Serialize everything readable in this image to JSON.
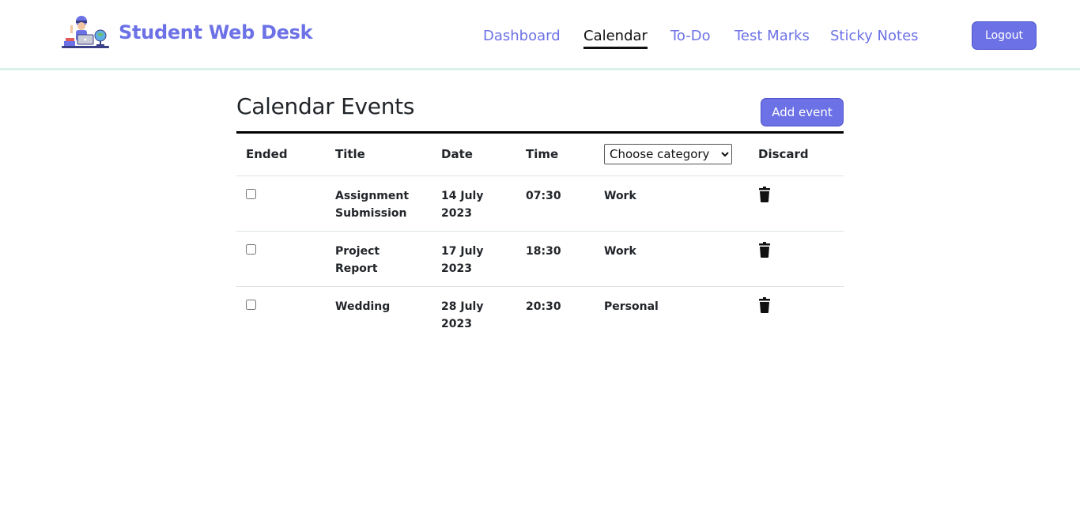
{
  "brand": {
    "name": "Student Web Desk",
    "logo_icon": "student-laptop-desk-icon"
  },
  "nav": {
    "items": [
      {
        "label": "Dashboard"
      },
      {
        "label": "Calendar"
      },
      {
        "label": "To-Do"
      },
      {
        "label": "Test Marks"
      },
      {
        "label": "Sticky Notes"
      }
    ],
    "active": "Calendar",
    "logout_label": "Logout"
  },
  "page": {
    "title": "Calendar Events",
    "add_event_label": "Add event"
  },
  "table": {
    "headers": {
      "ended": "Ended",
      "title": "Title",
      "date": "Date",
      "time": "Time",
      "discard": "Discard"
    },
    "category_filter": {
      "selected": "Choose category",
      "options": [
        "Choose category"
      ]
    },
    "rows": [
      {
        "ended": false,
        "title": "Assignment Submission",
        "date": "14 July 2023",
        "time": "07:30",
        "category": "Work"
      },
      {
        "ended": false,
        "title": "Project Report",
        "date": "17 July 2023",
        "time": "18:30",
        "category": "Work"
      },
      {
        "ended": false,
        "title": "Wedding",
        "date": "28 July 2023",
        "time": "20:30",
        "category": "Personal"
      }
    ],
    "discard_icon": "trash-icon"
  },
  "colors": {
    "accent": "#6c72e6",
    "nav_border": "#dbf2ec",
    "text": "#212529"
  }
}
